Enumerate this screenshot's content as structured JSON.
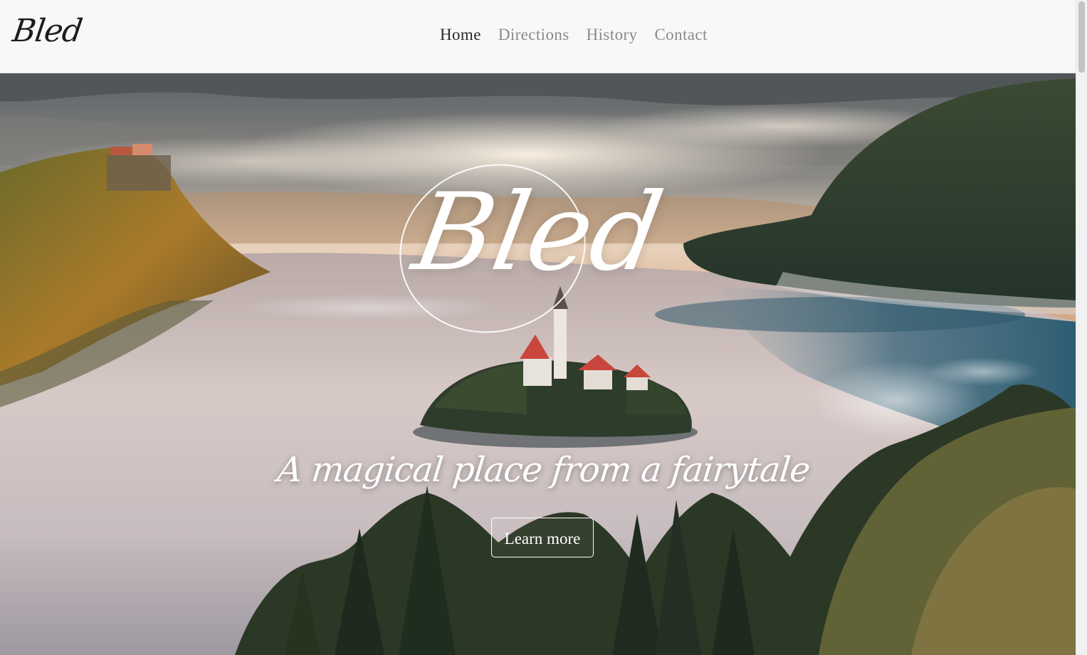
{
  "navbar": {
    "brand": "Bled",
    "links": [
      {
        "label": "Home",
        "active": true
      },
      {
        "label": "Directions",
        "active": false
      },
      {
        "label": "History",
        "active": false
      },
      {
        "label": "Contact",
        "active": false
      }
    ]
  },
  "hero": {
    "title": "Bled",
    "tagline": "A magical place from a fairytale",
    "cta_label": "Learn more"
  },
  "colors": {
    "navbar_bg": "#f7f8fa",
    "nav_active": "#2a2a2a",
    "nav_inactive": "#8a8a8a",
    "hero_text": "#ffffff"
  }
}
